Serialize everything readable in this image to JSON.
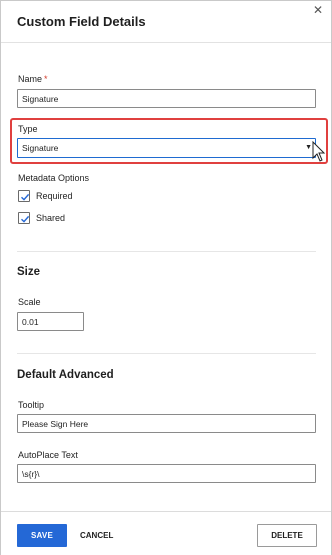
{
  "header": {
    "title": "Custom Field Details",
    "close_icon": "close-icon"
  },
  "fields": {
    "name": {
      "label": "Name",
      "required_mark": "*",
      "value": "Signature"
    },
    "type": {
      "label": "Type",
      "selected": "Signature",
      "arrow": "▼"
    },
    "metadata": {
      "label": "Metadata Options",
      "options": [
        {
          "label": "Required",
          "checked": true
        },
        {
          "label": "Shared",
          "checked": true
        }
      ]
    }
  },
  "size_section": {
    "title": "Size",
    "scale": {
      "label": "Scale",
      "value": "0.01"
    }
  },
  "advanced_section": {
    "title": "Default Advanced",
    "tooltip": {
      "label": "Tooltip",
      "value": "Please Sign Here"
    },
    "autoplace": {
      "label": "AutoPlace Text",
      "value": "\\s{r}\\"
    }
  },
  "footer": {
    "save_label": "SAVE",
    "cancel_label": "CANCEL",
    "delete_label": "DELETE"
  },
  "colors": {
    "accent": "#2468d6",
    "highlight": "#e0403f",
    "required": "#d23a2a"
  }
}
